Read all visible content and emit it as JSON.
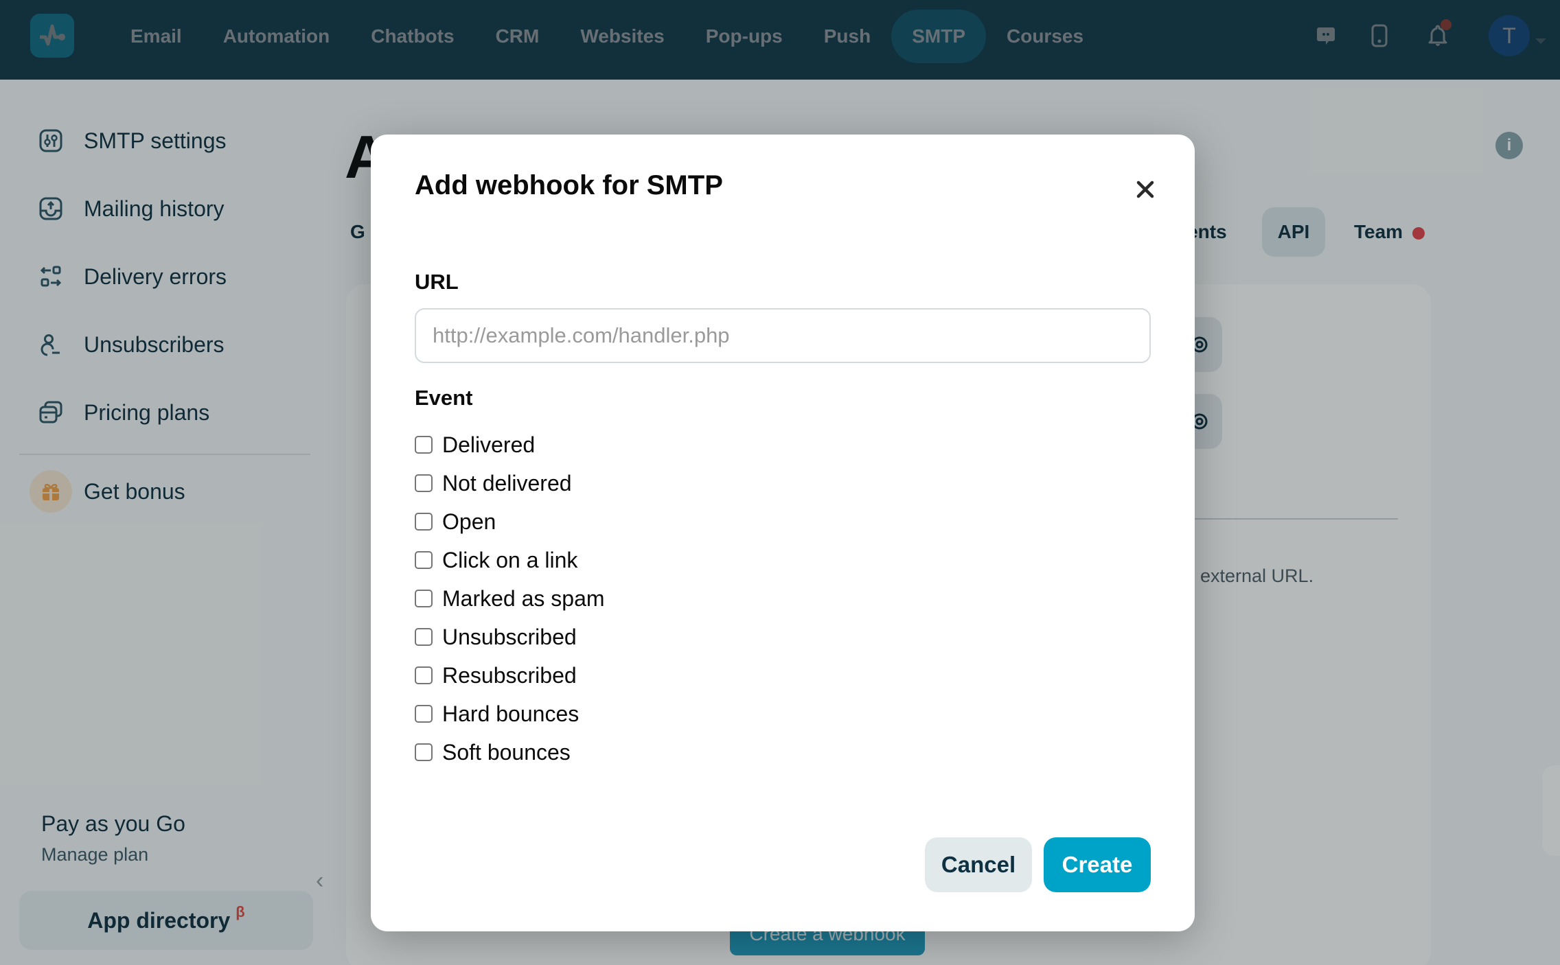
{
  "header": {
    "logo_icon": "pulse-logo-icon",
    "nav": [
      {
        "label": "Email",
        "active": false
      },
      {
        "label": "Automation",
        "active": false
      },
      {
        "label": "Chatbots",
        "active": false
      },
      {
        "label": "CRM",
        "active": false
      },
      {
        "label": "Websites",
        "active": false
      },
      {
        "label": "Pop-ups",
        "active": false
      },
      {
        "label": "Push",
        "active": false
      },
      {
        "label": "SMTP",
        "active": true
      },
      {
        "label": "Courses",
        "active": false
      }
    ],
    "icons": [
      "chat-icon",
      "mobile-icon",
      "bell-icon"
    ],
    "notification_dot": true,
    "avatar_initial": "T"
  },
  "sidebar": {
    "items": [
      {
        "label": "SMTP settings",
        "icon": "settings-sliders-icon"
      },
      {
        "label": "Mailing history",
        "icon": "inbox-upload-icon"
      },
      {
        "label": "Delivery errors",
        "icon": "transfer-arrows-icon"
      },
      {
        "label": "Unsubscribers",
        "icon": "user-minus-icon"
      },
      {
        "label": "Pricing plans",
        "icon": "cards-icon"
      }
    ],
    "bonus": {
      "label": "Get bonus",
      "icon": "gift-icon"
    },
    "plan": {
      "name": "Pay as you Go",
      "manage_label": "Manage plan"
    },
    "app_directory": {
      "label": "App directory",
      "badge": "β"
    }
  },
  "background": {
    "page_title_partial": "A",
    "tabs": [
      {
        "label": "G",
        "partial": true
      },
      {
        "label": "nents",
        "partial": true
      },
      {
        "label": "API",
        "active": true
      },
      {
        "label": "Team",
        "has_dot": true
      }
    ],
    "card_text_partial": "external URL.",
    "create_webhook_label": "Create a webhook"
  },
  "modal": {
    "title": "Add webhook for SMTP",
    "url_label": "URL",
    "url_value": "",
    "url_placeholder": "http://example.com/handler.php",
    "event_label": "Event",
    "events": [
      {
        "label": "Delivered",
        "checked": false
      },
      {
        "label": "Not delivered",
        "checked": false
      },
      {
        "label": "Open",
        "checked": false
      },
      {
        "label": "Click on a link",
        "checked": false
      },
      {
        "label": "Marked as spam",
        "checked": false
      },
      {
        "label": "Unsubscribed",
        "checked": false
      },
      {
        "label": "Resubscribed",
        "checked": false
      },
      {
        "label": "Hard bounces",
        "checked": false
      },
      {
        "label": "Soft bounces",
        "checked": false
      }
    ],
    "cancel_label": "Cancel",
    "create_label": "Create"
  },
  "colors": {
    "header_bg": "#1e5a6f",
    "accent": "#00a3c8",
    "nav_active": "#1f83a3",
    "alert_red": "#e0444a"
  }
}
